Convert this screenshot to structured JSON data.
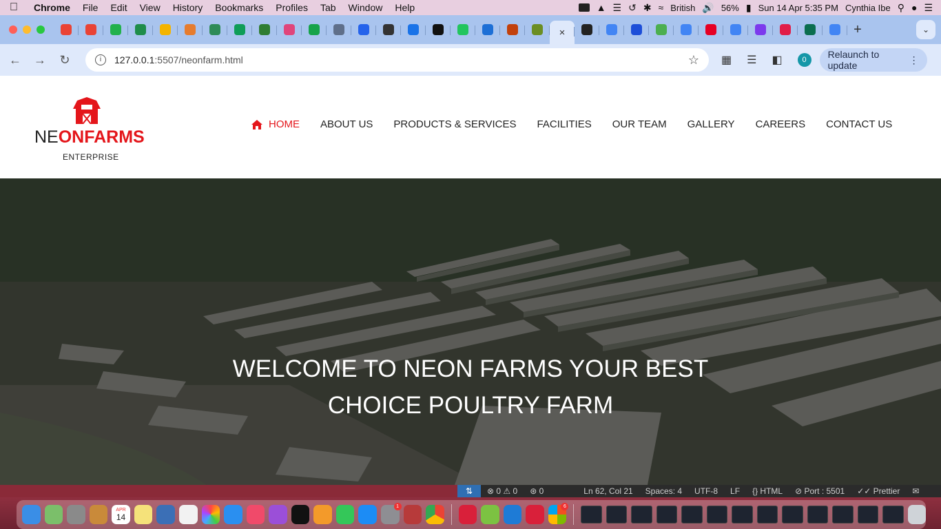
{
  "menubar": {
    "app_name": "Chrome",
    "items": [
      "File",
      "Edit",
      "View",
      "History",
      "Bookmarks",
      "Profiles",
      "Tab",
      "Window",
      "Help"
    ],
    "input_source": "British",
    "battery": "56%",
    "datetime": "Sun 14 Apr  5:35 PM",
    "user": "Cynthia Ibe"
  },
  "browser": {
    "tab_favicon_colors": [
      "#ea4335",
      "#e94335",
      "#22b14c",
      "#1f8d4a",
      "#f4b400",
      "#e67c2e",
      "#2e8b57",
      "#0f9d58",
      "#2f7d32",
      "#e0457b",
      "#16a34a",
      "#5f6f8a",
      "#2563eb",
      "#333333",
      "#1a73e8",
      "#111111",
      "#22c55e",
      "#1d6fd6",
      "#c2410c",
      "#6b8e23"
    ],
    "tab_favicon_colors_right": [
      "#222222",
      "#4285f4",
      "#1d4ed8",
      "#4caf50",
      "#4285f4",
      "#e60023",
      "#4285f4",
      "#7c3aed",
      "#e11d48",
      "#0b6e4f",
      "#4285f4"
    ],
    "new_tab_label": "+",
    "close_tab_label": "×",
    "url_host": "127.0.0.1",
    "url_path": ":5507/neonfarm.html",
    "profile_badge": "0",
    "relaunch_label": "Relaunch to update"
  },
  "site": {
    "logo": {
      "ne": "NE",
      "on": "ON",
      "farms": "FARMS",
      "sub": "ENTERPRISE"
    },
    "nav": {
      "home": "HOME",
      "about": "ABOUT US",
      "products": "PRODUCTS & SERVICES",
      "facilities": "FACILITIES",
      "team": "OUR TEAM",
      "gallery": "GALLERY",
      "careers": "CAREERS",
      "contact": "CONTACT US"
    },
    "hero": {
      "title_line1": "WELCOME TO NEON FARMS YOUR BEST",
      "title_line2": "CHOICE POULTRY FARM"
    },
    "brand_color": "#e4161b"
  },
  "statusbar": {
    "errors": "0",
    "warnings": "0",
    "ports": "0",
    "cursor": "Ln 62, Col 21",
    "spaces": "Spaces: 4",
    "encoding": "UTF-8",
    "eol": "LF",
    "language": "HTML",
    "port": "Port : 5501",
    "formatter": "Prettier"
  },
  "dock": {
    "calendar_month": "APR",
    "calendar_day": "14",
    "badge_settings": "1",
    "badge_office": "6"
  }
}
